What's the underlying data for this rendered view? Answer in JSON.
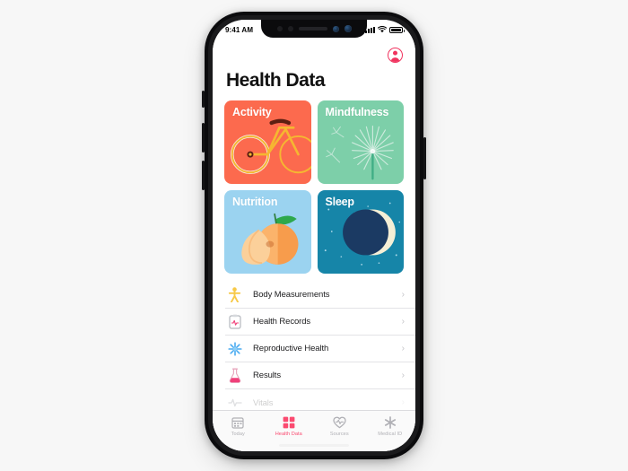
{
  "scene": {
    "background_color": "#f7f7f7",
    "device": "iphone-x-mockup"
  },
  "status_bar": {
    "time": "9:41 AM",
    "signal_icon": "cellular-bars-icon",
    "wifi_icon": "wifi-icon",
    "battery_icon": "battery-icon"
  },
  "nav": {
    "profile_icon": "profile-avatar-icon",
    "profile_accent": "#f0335e"
  },
  "header": {
    "title": "Health Data"
  },
  "tiles": [
    {
      "label": "Activity",
      "color": "#fc6a4e",
      "icon": "bicycle-illustration",
      "accent": "#f5b731"
    },
    {
      "label": "Mindfulness",
      "color": "#7dcfa9",
      "icon": "dandelion-illustration",
      "accent": "#c8ece0"
    },
    {
      "label": "Nutrition",
      "color": "#9bd3f0",
      "icon": "peach-illustration",
      "accent": "#f79c4c"
    },
    {
      "label": "Sleep",
      "color": "#1685a8",
      "icon": "crescent-moon-illustration",
      "accent": "#f5efd6"
    }
  ],
  "list": {
    "chevron": "›",
    "rows": [
      {
        "label": "Body Measurements",
        "icon": "body-figure-icon",
        "color": "#f7c948",
        "faded": false
      },
      {
        "label": "Health Records",
        "icon": "clipboard-records-icon",
        "color": "#9aa0a6",
        "faded": false
      },
      {
        "label": "Reproductive Health",
        "icon": "snowflake-flower-icon",
        "color": "#4aabf0",
        "faded": false
      },
      {
        "label": "Results",
        "icon": "flask-icon",
        "color": "#f0407a",
        "faded": false
      },
      {
        "label": "Vitals",
        "icon": "heart-vitals-icon",
        "color": "#9aa0a6",
        "faded": true
      }
    ]
  },
  "tabbar": {
    "active_color": "#fb4a70",
    "inactive_color": "#b0b0b5",
    "tabs": [
      {
        "label": "Today",
        "icon": "calendar-icon",
        "active": false
      },
      {
        "label": "Health Data",
        "icon": "health-grid-icon",
        "active": true
      },
      {
        "label": "Sources",
        "icon": "heart-sources-icon",
        "active": false
      },
      {
        "label": "Medical ID",
        "icon": "medical-asterisk-icon",
        "active": false
      }
    ]
  }
}
